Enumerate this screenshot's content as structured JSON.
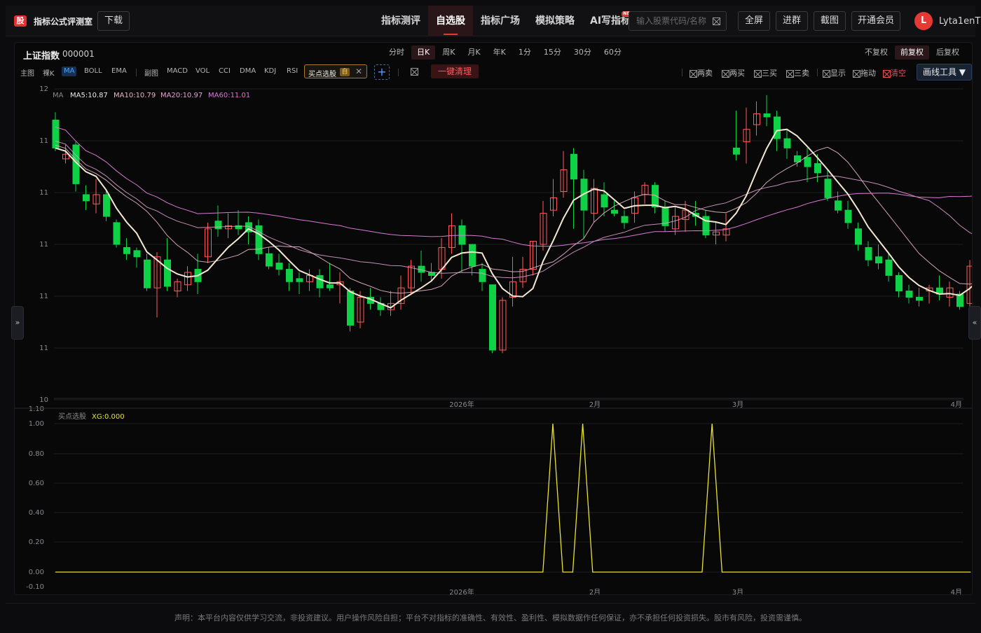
{
  "app": {
    "logo": "股",
    "title": "指标公式评测室",
    "download": "下载"
  },
  "nav": [
    {
      "label": "指标测评",
      "active": false
    },
    {
      "label": "自选股",
      "active": true
    },
    {
      "label": "指标广场",
      "active": false
    },
    {
      "label": "模拟策略",
      "active": false
    },
    {
      "label": "AI写指标",
      "active": false,
      "badge": "NEW"
    }
  ],
  "search": {
    "placeholder": "输入股票代码/名称"
  },
  "topbuttons": {
    "fullscreen": "全屏",
    "advanced": "进群",
    "screenshot": "截图",
    "vip": "开通会员"
  },
  "user": {
    "initial": "L",
    "name": "Lyta1enT"
  },
  "stock": {
    "name": "上证指数",
    "code": "000001"
  },
  "periods": [
    {
      "label": "分时",
      "active": false
    },
    {
      "label": "日K",
      "active": true
    },
    {
      "label": "周K",
      "active": false
    },
    {
      "label": "月K",
      "active": false
    },
    {
      "label": "年K",
      "active": false
    },
    {
      "label": "1分",
      "active": false
    },
    {
      "label": "15分",
      "active": false
    },
    {
      "label": "30分",
      "active": false
    },
    {
      "label": "60分",
      "active": false
    }
  ],
  "adjust": [
    {
      "label": "不复权",
      "active": false
    },
    {
      "label": "前复权",
      "active": true
    },
    {
      "label": "后复权",
      "active": false
    }
  ],
  "indicators": {
    "main_label": "主图",
    "bare": "裸K",
    "ma": "MA",
    "boll": "BOLL",
    "ema": "EMA",
    "sub_label": "副图",
    "macd": "MACD",
    "vol": "VOL",
    "cci": "CCI",
    "dma": "DMA",
    "kdj": "KDJ",
    "rsi": "RSI",
    "chip_label": "买点选股",
    "chip_badge": "自",
    "clear": "一键清理"
  },
  "toggles": {
    "sell2": "两卖",
    "buy2": "两买",
    "buy3": "三买",
    "sell3": "三卖",
    "show": "显示",
    "drag": "拖动",
    "clear": "清空",
    "draw": "画线工具 ▼"
  },
  "legend": {
    "main": {
      "tag": "MA",
      "ma5": "MA5:10.87",
      "ma10": "MA10:10.79",
      "ma20": "MA20:10.97",
      "ma60": "MA60:11.01"
    },
    "sub": {
      "tag": "买点选股",
      "xg": "XG:0.000"
    }
  },
  "colors": {
    "up": "#ff5a5a",
    "down": "#0ed145",
    "ma5": "#f3e7d2",
    "ma10": "#e8b7c8",
    "ma20": "#e2a6d2",
    "ma60": "#d77ad0",
    "xg": "#e8e22a"
  },
  "chart_data": [
    {
      "type": "candlestick",
      "y_ticks": [
        "12",
        "11",
        "11",
        "11",
        "11",
        "11",
        "10"
      ],
      "x_ticks": [
        "2026年",
        "2月",
        "3月",
        "4月"
      ]
    },
    {
      "type": "line",
      "series": [
        {
          "name": "XG",
          "values": [
            0,
            0,
            0,
            0,
            0,
            0,
            0,
            0,
            0,
            0,
            0,
            0,
            0,
            0,
            0,
            0,
            0,
            0,
            0,
            0,
            0,
            0,
            0,
            0,
            0,
            0,
            0,
            0,
            0,
            0,
            0,
            0,
            0,
            0,
            0,
            0,
            0,
            0,
            0,
            0,
            0,
            0,
            0,
            0,
            0,
            0,
            0,
            0,
            0,
            0,
            1,
            0,
            0,
            1,
            0,
            0,
            0,
            0,
            0,
            0,
            0,
            0,
            0,
            0,
            0,
            0,
            1,
            0,
            0,
            0,
            0,
            0,
            0,
            0,
            0,
            0,
            0,
            0,
            0,
            0,
            0,
            0,
            0,
            0,
            0,
            0,
            0,
            0,
            0,
            0,
            0,
            0,
            0
          ]
        }
      ],
      "y_ticks": [
        "1.10",
        "1.00",
        "0.80",
        "0.60",
        "0.40",
        "0.20",
        "0.00",
        "-0.10"
      ],
      "x_ticks": [
        "2026年",
        "2月",
        "3月",
        "4月"
      ]
    }
  ]
}
